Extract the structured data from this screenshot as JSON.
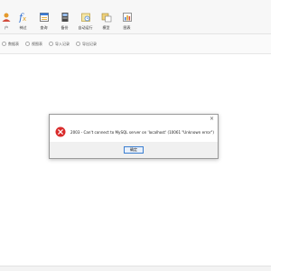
{
  "toolbar": {
    "items": [
      {
        "label": "户",
        "icon": "user-icon"
      },
      {
        "label": "神过",
        "icon": "function-icon"
      },
      {
        "label": "查询",
        "icon": "query-icon"
      },
      {
        "label": "备份",
        "icon": "backup-icon"
      },
      {
        "label": "自动运行",
        "icon": "schedule-icon"
      },
      {
        "label": "模型",
        "icon": "model-icon"
      },
      {
        "label": "图表",
        "icon": "chart-icon"
      }
    ]
  },
  "tabs": [
    {
      "label": "数据表"
    },
    {
      "label": "视图表"
    },
    {
      "label": "导入记录"
    },
    {
      "label": "导出记录"
    }
  ],
  "dialog": {
    "close_glyph": "×",
    "message": "2003 - Can't connect to MySQL server on 'localhost' (10061 \"Unknown error\")",
    "ok_label": "确定",
    "icon": "error-icon"
  },
  "colors": {
    "error_red": "#d92b2b",
    "button_border": "#3c7fd1"
  }
}
